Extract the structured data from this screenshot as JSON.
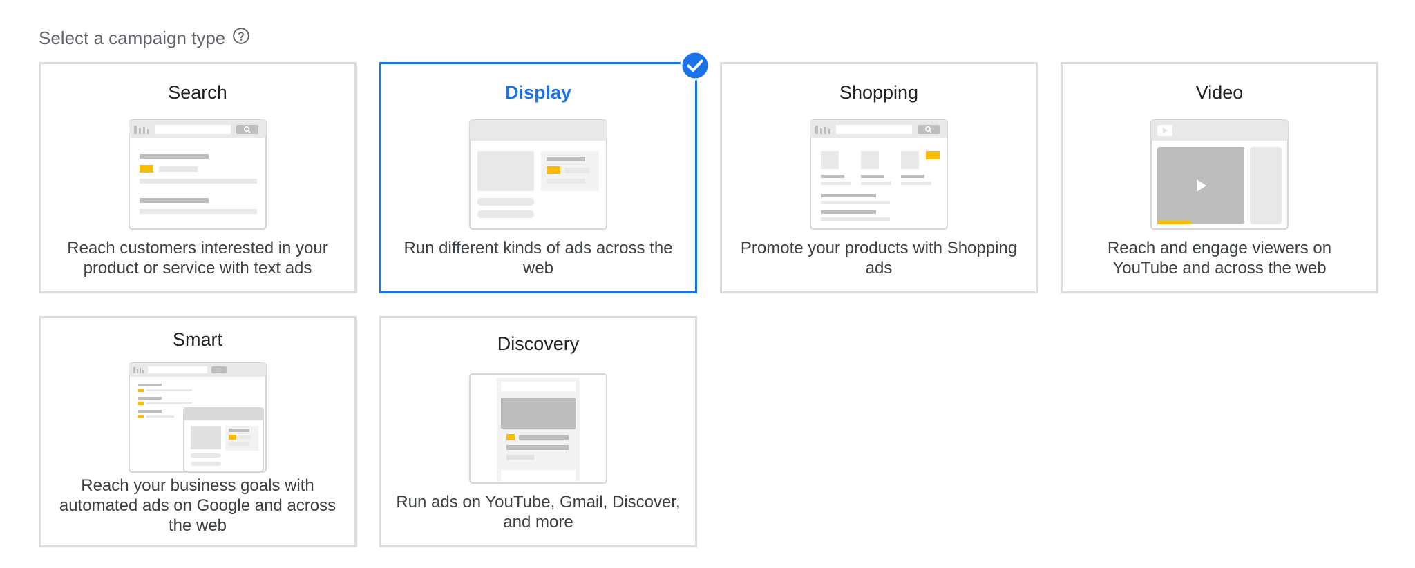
{
  "heading": {
    "text": "Select a campaign type",
    "help_icon": "help-circle-icon"
  },
  "cards": [
    {
      "id": "search",
      "title": "Search",
      "description": "Reach customers interested in your product or service with text ads",
      "selected": false
    },
    {
      "id": "display",
      "title": "Display",
      "description": "Run different kinds of ads across the web",
      "selected": true
    },
    {
      "id": "shopping",
      "title": "Shopping",
      "description": "Promote your products with Shopping ads",
      "selected": false
    },
    {
      "id": "video",
      "title": "Video",
      "description": "Reach and engage viewers on YouTube and across the web",
      "selected": false
    },
    {
      "id": "smart",
      "title": "Smart",
      "description": "Reach your business goals with automated ads on Google and across the web",
      "selected": false
    },
    {
      "id": "discovery",
      "title": "Discovery",
      "description": "Run ads on YouTube, Gmail, Discover, and more",
      "selected": false
    }
  ],
  "colors": {
    "accent": "#1a73e8",
    "card_border": "#dadce0",
    "ad_highlight": "#fbbc04",
    "illus_gray": "#bdbdbd",
    "illus_light": "#e8e8e8"
  },
  "icons": {
    "selected_badge": "check-circle-icon"
  }
}
